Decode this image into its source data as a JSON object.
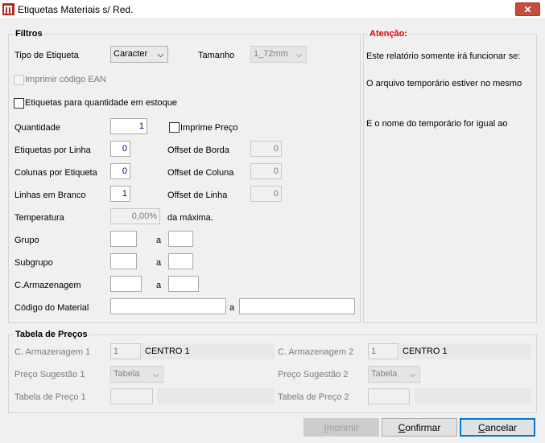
{
  "window": {
    "title": "Etiquetas Materiais s/ Red.",
    "close_glyph": "✕"
  },
  "filtros": {
    "legend": "Filtros",
    "tipo_etiqueta_label": "Tipo de Etiqueta",
    "tipo_etiqueta_value": "Caracter",
    "tamanho_label": "Tamanho",
    "tamanho_value": "1_72mm",
    "ean_label": "Imprimir código EAN",
    "ean_checked": false,
    "qtd_estoque_label": "Etiquetas para quantidade em estoque",
    "qtd_estoque_checked": false,
    "quantidade_label": "Quantidade",
    "quantidade_value": "1",
    "imprime_preco_label": "Imprime Preço",
    "imprime_preco_checked": false,
    "etq_linha_label": "Etiquetas por Linha",
    "etq_linha_value": "0",
    "offset_borda_label": "Offset de Borda",
    "offset_borda_value": "0",
    "col_etq_label": "Colunas por Etiqueta",
    "col_etq_value": "0",
    "offset_coluna_label": "Offset de Coluna",
    "offset_coluna_value": "0",
    "linhas_branco_label": "Linhas em Branco",
    "linhas_branco_value": "1",
    "offset_linha_label": "Offset de Linha",
    "offset_linha_value": "0",
    "temperatura_label": "Temperatura",
    "temperatura_value": "0,00%",
    "temperatura_suffix": "da máxima.",
    "grupo_label": "Grupo",
    "subgrupo_label": "Subgrupo",
    "armazenagem_label": "C.Armazenagem",
    "codigo_label": "Código do Material",
    "range_a": "a"
  },
  "atencao": {
    "legend": "Atenção:",
    "line1": "Este relatório somente irá funcionar se:",
    "line2": "O arquivo temporário estiver no mesmo",
    "line3": "E o nome do temporário  for igual ao"
  },
  "tabela": {
    "legend": "Tabela de Preços",
    "arm1_label": "C. Armazenagem 1",
    "arm1_value": "1",
    "arm1_desc": "CENTRO 1",
    "arm2_label": "C. Armazenagem 2",
    "arm2_value": "1",
    "arm2_desc": "CENTRO 1",
    "preco1_label": "Preço Sugestão  1",
    "preco1_value": "Tabela",
    "preco2_label": "Preço Sugestão  2",
    "preco2_value": "Tabela",
    "tab1_label": "Tabela de Preço 1",
    "tab2_label": "Tabela de Preço 2"
  },
  "buttons": {
    "imprimir": {
      "first": "I",
      "rest": "mprimir"
    },
    "confirmar": {
      "first": "C",
      "rest": "onfirmar"
    },
    "cancelar": {
      "first": "C",
      "rest": "ancelar"
    }
  },
  "colors": {
    "accent": "#0078d7",
    "close": "#c74b3f",
    "warning": "#e50000",
    "number": "#00007f"
  }
}
